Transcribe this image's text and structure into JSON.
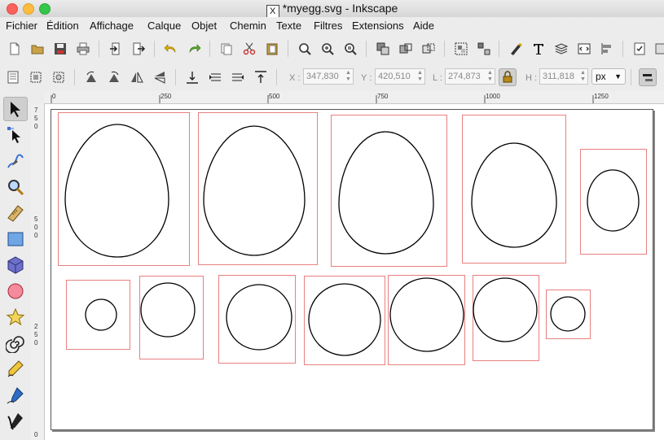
{
  "window": {
    "title": "*myegg.svg - Inkscape",
    "x11_badge": "X"
  },
  "menu": [
    "Fichier",
    "Édition",
    "Affichage",
    "Calque",
    "Objet",
    "Chemin",
    "Texte",
    "Filtres",
    "Extensions",
    "Aide"
  ],
  "toolbar": {
    "x_label": "X :",
    "x_value": "347,830",
    "y_label": "Y :",
    "y_value": "420,510",
    "w_label": "L :",
    "w_value": "274,873",
    "h_label": "H :",
    "h_value": "311,818",
    "unit": "px"
  },
  "ruler": {
    "top_ticks": [
      "0",
      "250",
      "500",
      "750",
      "1000",
      "1250"
    ],
    "left_labels": [
      "7",
      "5",
      "0",
      "5",
      "0",
      "0",
      "2",
      "5",
      "0",
      "0"
    ]
  },
  "colors": {
    "bbox": "#e88080",
    "stroke": "#000000",
    "page_bg": "#ffffff"
  },
  "icons": {
    "tools": [
      "selector-arrow-icon",
      "node-edit-icon",
      "tweak-icon",
      "zoom-icon",
      "measure-icon",
      "rectangle-icon",
      "3d-box-icon",
      "ellipse-icon",
      "star-icon",
      "spiral-icon",
      "pencil-icon",
      "pen-icon",
      "calligraphy-icon"
    ]
  }
}
